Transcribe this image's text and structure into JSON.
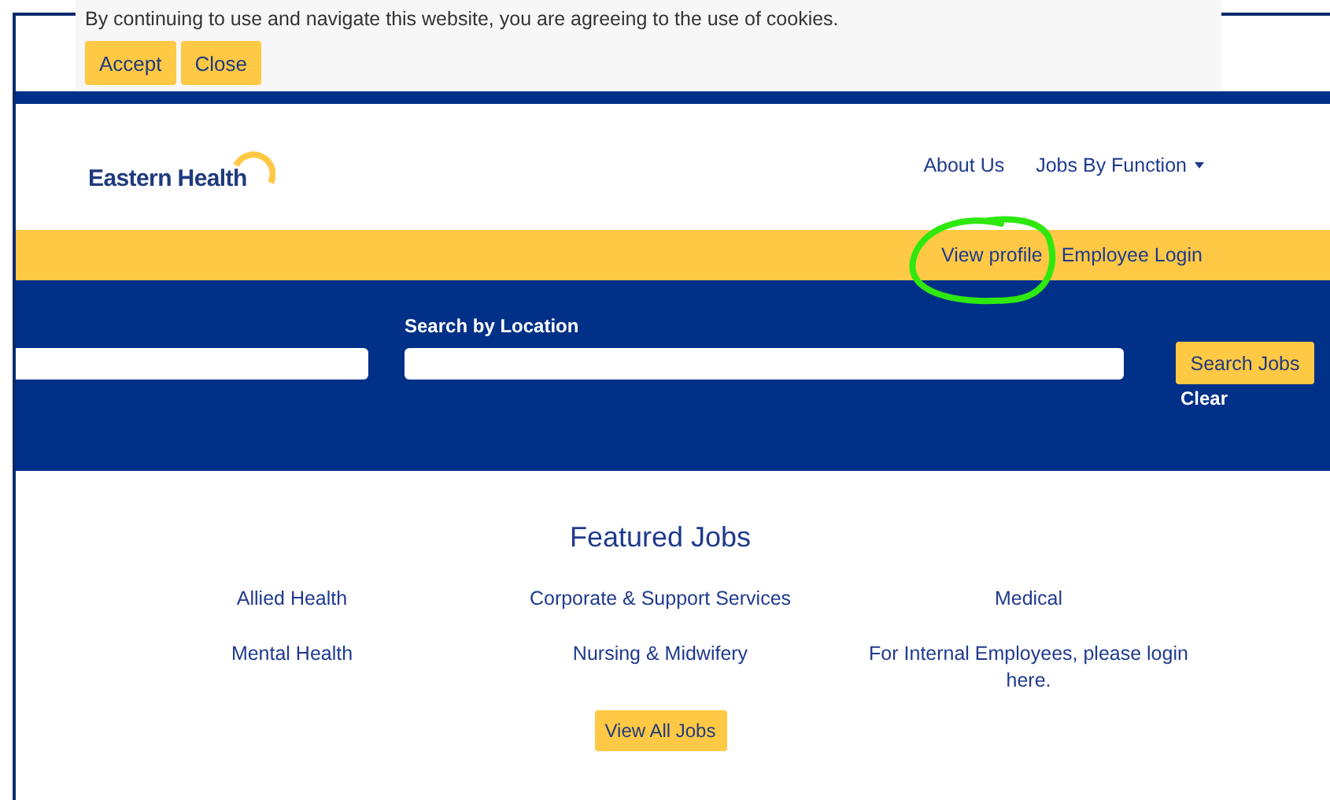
{
  "cookie_banner": {
    "message": "By continuing to use and navigate this website, you are agreeing to the use of cookies.",
    "buttons": [
      "Accept",
      "Close"
    ]
  },
  "header": {
    "logo": "Eastern Health",
    "nav": [
      {
        "label": "About Us",
        "dropdown": false
      },
      {
        "label": "Jobs By Function",
        "dropdown": true
      }
    ]
  },
  "utility_bar": {
    "links": [
      "View profile",
      "Employee Login"
    ]
  },
  "search": {
    "location_label": "Search by Location",
    "button": "Search Jobs",
    "clear": "Clear"
  },
  "featured": {
    "title": "Featured Jobs",
    "links": [
      "Allied Health",
      "Corporate & Support Services",
      "Medical",
      "Mental Health",
      "Nursing & Midwifery",
      "For Internal Employees, please login here."
    ],
    "button": "View All Jobs"
  }
}
